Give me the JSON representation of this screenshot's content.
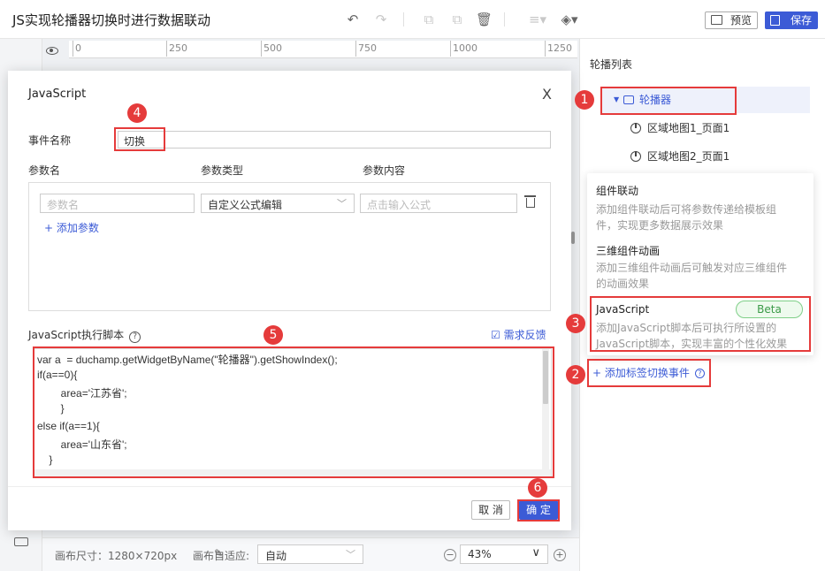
{
  "app": {
    "title": "JS实现轮播器切换时进行数据联动"
  },
  "toolbar": {
    "icons": [
      "undo-icon",
      "redo-icon",
      "copy-icon",
      "paste-icon",
      "delete-icon",
      "align-icon",
      "layer-icon"
    ],
    "preview_label": "预览",
    "save_label": "保存"
  },
  "ruler": {
    "ticks": [
      "0",
      "250",
      "500",
      "750",
      "1000",
      "1250"
    ]
  },
  "bottom_bar": {
    "canvas_size": "画布尺寸：1280×720px",
    "fit_label": "画布自适应:",
    "fit_value": "自动",
    "zoom_value": "43%"
  },
  "right_panel": {
    "title": "轮播列表",
    "tree": [
      {
        "label": "轮播器",
        "selected": true
      },
      {
        "label": "区域地图1_页面1"
      },
      {
        "label": "区域地图2_页面1"
      }
    ],
    "add_event_label": "+ 添加标签切换事件"
  },
  "popup": {
    "items": [
      {
        "title": "组件联动",
        "desc": "添加组件联动后可将参数传递给模板组件，实现更多数据展示效果"
      },
      {
        "title": "三维组件动画",
        "desc": "添加三维组件动画后可触发对应三维组件的动画效果"
      },
      {
        "title": "JavaScript",
        "desc": "添加JavaScript脚本后可执行所设置的JavaScript脚本，实现丰富的个性化效果",
        "badge": "Beta"
      }
    ]
  },
  "dialog": {
    "title": "JavaScript",
    "close": "X",
    "event_name_label": "事件名称",
    "event_name_value": "切换",
    "col_param_name": "参数名",
    "col_param_type": "参数类型",
    "col_param_value": "参数内容",
    "param_name_placeholder": "参数名",
    "param_type_value": "自定义公式编辑",
    "param_value_placeholder": "点击输入公式",
    "add_param_label": "+ 添加参数",
    "script_label": "JavaScript执行脚本",
    "feedback_label": "需求反馈",
    "code_lines": [
      "var a  = duchamp.getWidgetByName(\"轮播器\").getShowIndex();",
      "if(a==0){",
      "        area='江苏省';",
      "        }",
      "else if(a==1){",
      "        area='山东省';",
      "    }"
    ],
    "cancel_label": "取 消",
    "ok_label": "确 定"
  },
  "annotations": {
    "steps": [
      "1",
      "2",
      "3",
      "4",
      "5",
      "6"
    ],
    "color": "#e53b3b"
  },
  "colors": {
    "accent": "#3c5bd6",
    "annotation": "#e53b3b",
    "beta": "#3a9a47"
  }
}
